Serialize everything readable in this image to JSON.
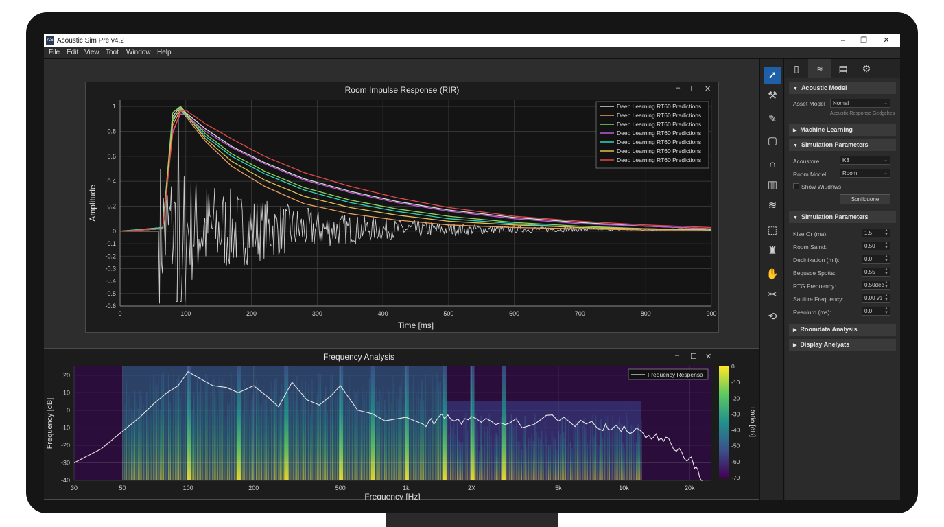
{
  "window": {
    "title": "Acoustic Sim Pre v4.2",
    "icon": "app-icon",
    "controls": [
      "–",
      "❐",
      "✕"
    ]
  },
  "menu": [
    "File",
    "Edit",
    "View",
    "Toot",
    "Window",
    "Help"
  ],
  "rir_panel": {
    "title": "Room Impulse Response (RIR)",
    "controls": [
      "–",
      "☐",
      "✕"
    ]
  },
  "freq_panel": {
    "title": "Frequency Analysis",
    "controls": [
      "–",
      "☐",
      "✕"
    ]
  },
  "toolstrip": [
    "pointer-icon",
    "magic-wand-icon",
    "pencil-icon",
    "rectangle-icon",
    "curve-icon",
    "histogram-icon",
    "waveform-icon",
    "grid-select-icon",
    "stamp-icon",
    "hand-icon",
    "crosshair-icon",
    "rotate-icon"
  ],
  "sidebar": {
    "tabs": [
      "document-icon",
      "spectrum-icon",
      "table-icon",
      "settings-icon"
    ],
    "sections": {
      "acoustic_model": "Acoustic Model",
      "machine_learning": "Machine Learning",
      "simulation_parameters": "Simulation Parameters",
      "simulation_parameters_2": "Simulation Parameters",
      "roomdata_analysis": "Roomdata Analysis",
      "display_analysis": "Display Anelyats"
    },
    "asset_model": {
      "label": "Asset Model",
      "value": "Nomal",
      "note": "Acoustic Response Gedgehes"
    },
    "acoustore": {
      "label": "Acoustore",
      "value": "K3"
    },
    "room_model": {
      "label": "Room Model",
      "value": "Room"
    },
    "show_windows": {
      "label": "Show Wiudnws",
      "checked": false
    },
    "configure_button": "Sonfiduone",
    "params": [
      {
        "label": "Kise Or (ma):",
        "value": "1.5"
      },
      {
        "label": "Room Saind:",
        "value": "0.50"
      },
      {
        "label": "Decinikation (mli):",
        "value": "0.0"
      },
      {
        "label": "Bequsce Spotts:",
        "value": "0.55"
      },
      {
        "label": "RTG Frequency:",
        "value": "0.50dec"
      },
      {
        "label": "Sauitire Frequency:",
        "value": "0.00 vs"
      },
      {
        "label": "Resoluro (ms):",
        "value": "0.0"
      }
    ]
  },
  "colors": {
    "accent": "#1f5fa8",
    "panel_bg": "#1c1c1c",
    "grid": "#3a3a3a"
  },
  "chart_data": [
    {
      "type": "line",
      "title": "Room Impulse Response (RIR)",
      "xlabel": "Time [ms]",
      "ylabel": "Amplitude",
      "xlim": [
        0,
        900
      ],
      "ylim": [
        -0.6,
        1.05
      ],
      "xticks": [
        "0",
        "100",
        "200",
        "300",
        "400",
        "500",
        "600",
        "700",
        "800",
        "900"
      ],
      "yticks": [
        "1",
        "0.8",
        "0.6",
        "0.4",
        "0.2",
        "0",
        "-0.1",
        "-0.2",
        "-0.3",
        "-0.4",
        "-0.5",
        "-0.6"
      ],
      "grid": true,
      "legend_position": "top-right",
      "series": [
        {
          "name": "Deep Learning RT60 Predictions",
          "color": "#d9d9d9",
          "x": [
            0,
            65,
            80,
            92,
            100,
            130,
            170,
            220,
            280,
            350,
            420,
            500,
            600,
            700,
            800,
            900
          ],
          "y": [
            0,
            0.03,
            0.92,
            1.0,
            0.95,
            0.82,
            0.68,
            0.55,
            0.42,
            0.32,
            0.24,
            0.17,
            0.11,
            0.07,
            0.04,
            0.02
          ]
        },
        {
          "name": "Deep Learning RT60 Predictions",
          "color": "#e8a060",
          "x": [
            0,
            65,
            80,
            92,
            100,
            130,
            170,
            220,
            280,
            350,
            420,
            500,
            600,
            700,
            800,
            900
          ],
          "y": [
            0,
            0.02,
            0.85,
            0.97,
            0.92,
            0.72,
            0.52,
            0.36,
            0.22,
            0.14,
            0.09,
            0.05,
            0.03,
            0.02,
            0.01,
            0.01
          ]
        },
        {
          "name": "Deep Learning RT60 Predictions",
          "color": "#8bd35a",
          "x": [
            0,
            65,
            80,
            92,
            100,
            130,
            170,
            220,
            280,
            350,
            420,
            500,
            600,
            700,
            800,
            900
          ],
          "y": [
            0,
            0.03,
            0.95,
            1.0,
            0.94,
            0.78,
            0.62,
            0.48,
            0.35,
            0.25,
            0.18,
            0.12,
            0.07,
            0.04,
            0.02,
            0.01
          ]
        },
        {
          "name": "Deep Learning RT60 Predictions",
          "color": "#c05ad8",
          "x": [
            0,
            65,
            80,
            92,
            100,
            130,
            170,
            220,
            280,
            350,
            420,
            500,
            600,
            700,
            800,
            900
          ],
          "y": [
            0,
            0.02,
            0.8,
            0.94,
            0.93,
            0.8,
            0.67,
            0.54,
            0.41,
            0.31,
            0.23,
            0.16,
            0.1,
            0.06,
            0.04,
            0.02
          ]
        },
        {
          "name": "Deep Learning RT60 Predictions",
          "color": "#2fd3c0",
          "x": [
            0,
            65,
            80,
            92,
            100,
            130,
            170,
            220,
            280,
            350,
            420,
            500,
            600,
            700,
            800,
            900
          ],
          "y": [
            0,
            0.03,
            0.9,
            0.98,
            0.93,
            0.76,
            0.6,
            0.46,
            0.33,
            0.23,
            0.16,
            0.1,
            0.06,
            0.03,
            0.02,
            0.01
          ]
        },
        {
          "name": "Deep Learning RT60 Predictions",
          "color": "#e0c050",
          "x": [
            0,
            65,
            80,
            92,
            100,
            130,
            170,
            220,
            280,
            350,
            420,
            500,
            600,
            700,
            800,
            900
          ],
          "y": [
            0,
            0.02,
            0.88,
            0.99,
            0.94,
            0.74,
            0.56,
            0.41,
            0.28,
            0.19,
            0.13,
            0.08,
            0.05,
            0.03,
            0.02,
            0.01
          ]
        },
        {
          "name": "Deep Learning RT60 Predictions",
          "color": "#e04a4a",
          "x": [
            0,
            65,
            80,
            92,
            100,
            130,
            170,
            220,
            280,
            350,
            420,
            500,
            600,
            700,
            800,
            900
          ],
          "y": [
            0,
            0.02,
            0.78,
            0.96,
            0.97,
            0.86,
            0.74,
            0.6,
            0.47,
            0.36,
            0.27,
            0.19,
            0.12,
            0.08,
            0.05,
            0.03
          ]
        }
      ],
      "impulse_trace": {
        "color": "#cccccc",
        "onset_ms": 60,
        "end_ms": 900,
        "peak": 1.0,
        "decay_ms": 180,
        "min": -0.58
      }
    },
    {
      "type": "heatmap",
      "title": "Frequency Analysis",
      "xlabel": "Frequency [Hz]",
      "ylabel": "Frequency [dB]",
      "xscale": "log",
      "xlim": [
        30,
        25000
      ],
      "ylim": [
        -40,
        25
      ],
      "xticks": [
        "30",
        "50",
        "100",
        "200",
        "500",
        "1k",
        "2X",
        "5k",
        "10k",
        "20k"
      ],
      "xtick_values": [
        30,
        50,
        100,
        200,
        500,
        1000,
        2000,
        5000,
        10000,
        20000
      ],
      "yticks": [
        "20",
        "10",
        "0",
        "-10",
        "-20",
        "-30",
        "-40"
      ],
      "colorbar": {
        "label": "Ratio [dB]",
        "ticks": [
          "0",
          "-10",
          "-20",
          "-30",
          "-40",
          "-50",
          "-60",
          "-70"
        ],
        "range": [
          -70,
          0
        ]
      },
      "series": [
        {
          "name": "Frequency Respensa",
          "color": "#e8e8e8",
          "x": [
            30,
            40,
            50,
            60,
            70,
            80,
            90,
            100,
            110,
            130,
            150,
            170,
            200,
            230,
            260,
            300,
            350,
            400,
            450,
            500,
            600,
            700,
            800,
            1000,
            1200,
            1500,
            2000,
            3000,
            5000,
            8000,
            10000,
            13000,
            16000,
            20000,
            23000
          ],
          "y": [
            -30,
            -22,
            -12,
            -4,
            4,
            10,
            14,
            22,
            19,
            14,
            13,
            10,
            14,
            8,
            2,
            16,
            6,
            3,
            8,
            14,
            0,
            -2,
            -6,
            -4,
            -8,
            -4,
            -6,
            -8,
            -5,
            -9,
            -10,
            -14,
            -18,
            -28,
            -40
          ]
        }
      ],
      "spectral_bands_hz": [
        100,
        170,
        280,
        500,
        700,
        1000,
        1500,
        2000,
        2800
      ]
    }
  ]
}
